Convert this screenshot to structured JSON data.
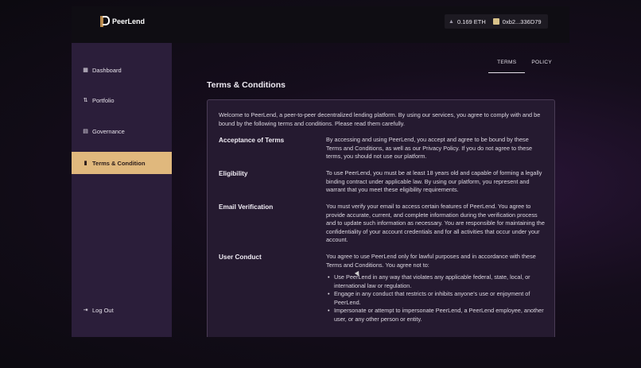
{
  "app": {
    "brand": "PeerLend"
  },
  "wallet": {
    "eth_balance": "0.169 ETH",
    "address": "0xb2...336D79"
  },
  "sidebar": {
    "items": [
      {
        "label": "Dashboard",
        "icon": "grid-icon"
      },
      {
        "label": "Portfolio",
        "icon": "transfer-icon"
      },
      {
        "label": "Governance",
        "icon": "building-icon"
      },
      {
        "label": "Terms & Condition",
        "icon": "document-icon",
        "active": true
      }
    ],
    "logout": "Log Out"
  },
  "tabs": [
    {
      "label": "TERMS",
      "active": true
    },
    {
      "label": "POLICY",
      "active": false
    }
  ],
  "page": {
    "title": "Terms & Conditions",
    "intro": "Welcome to PeerLend, a peer-to-peer decentralized lending platform. By using our services, you agree to comply with and be bound by the following terms and conditions. Please read them carefully.",
    "sections": [
      {
        "title": "Acceptance of Terms",
        "body": "By accessing and using PeerLend, you accept and agree to be bound by these Terms and Conditions, as well as our Privacy Policy. If you do not agree to these terms, you should not use our platform."
      },
      {
        "title": "Eligibility",
        "body": "To use PeerLend, you must be at least 18 years old and capable of forming a legally binding contract under applicable law. By using our platform, you represent and warrant that you meet these eligibility requirements."
      },
      {
        "title": "Email Verification",
        "body": "You must verify your email to access certain features of PeerLend. You agree to provide accurate, current, and complete information during the verification process and to update such information as necessary. You are responsible for maintaining the confidentiality of your account credentials and for all activities that occur under your account."
      },
      {
        "title": "User Conduct",
        "body": "You agree to use PeerLend only for lawful purposes and in accordance with these Terms and Conditions. You agree not to:",
        "bullets": [
          "Use PeerLend in any way that violates any applicable federal, state, local, or international law or regulation.",
          "Engage in any conduct that restricts or inhibits anyone's use or enjoyment of PeerLend.",
          "Impersonate or attempt to impersonate PeerLend, a PeerLend employee, another user, or any other person or entity."
        ]
      }
    ]
  }
}
